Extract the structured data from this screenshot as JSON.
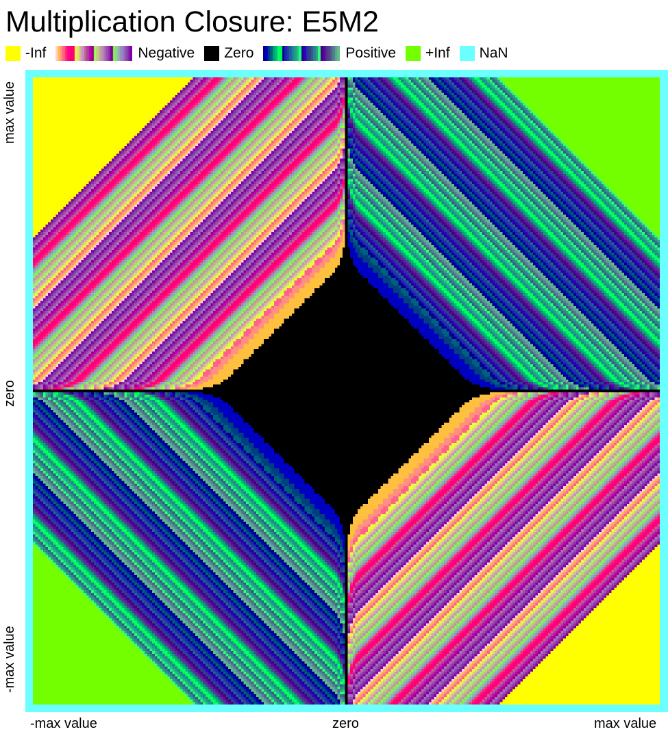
{
  "chart_data": {
    "type": "heatmap",
    "title": "Multiplication Closure: E5M2",
    "format": "E5M2",
    "operation": "multiplication",
    "exponent_bits": 5,
    "mantissa_bits": 2,
    "x_axis": {
      "label": "",
      "tick_labels": [
        "-max value",
        "zero",
        "max value"
      ],
      "range": [
        "-max value",
        "max value"
      ]
    },
    "y_axis": {
      "label": "",
      "tick_labels": [
        "-max value",
        "zero",
        "max value"
      ],
      "range": [
        "-max value",
        "max value"
      ]
    },
    "legend": {
      "placement": "top",
      "entries": [
        {
          "label": "-Inf",
          "kind": "swatch",
          "color": "#ffff00"
        },
        {
          "label": "Negative",
          "kind": "gradient"
        },
        {
          "label": "Zero",
          "kind": "swatch",
          "color": "#000000"
        },
        {
          "label": "Positive",
          "kind": "gradient"
        },
        {
          "label": "+Inf",
          "kind": "swatch",
          "color": "#73ff00"
        },
        {
          "label": "NaN",
          "kind": "swatch",
          "color": "#6cffff"
        }
      ]
    },
    "colors": {
      "neg_inf": "#ffff00",
      "pos_inf": "#73ff00",
      "zero": "#000000",
      "nan": "#6cffff"
    },
    "quadrants": {
      "top-left": "negative products / -Inf overflow",
      "top-right": "positive products / +Inf overflow",
      "bottom-left": "positive products / +Inf overflow",
      "bottom-right": "negative products / -Inf overflow",
      "center": "underflow to zero"
    }
  }
}
